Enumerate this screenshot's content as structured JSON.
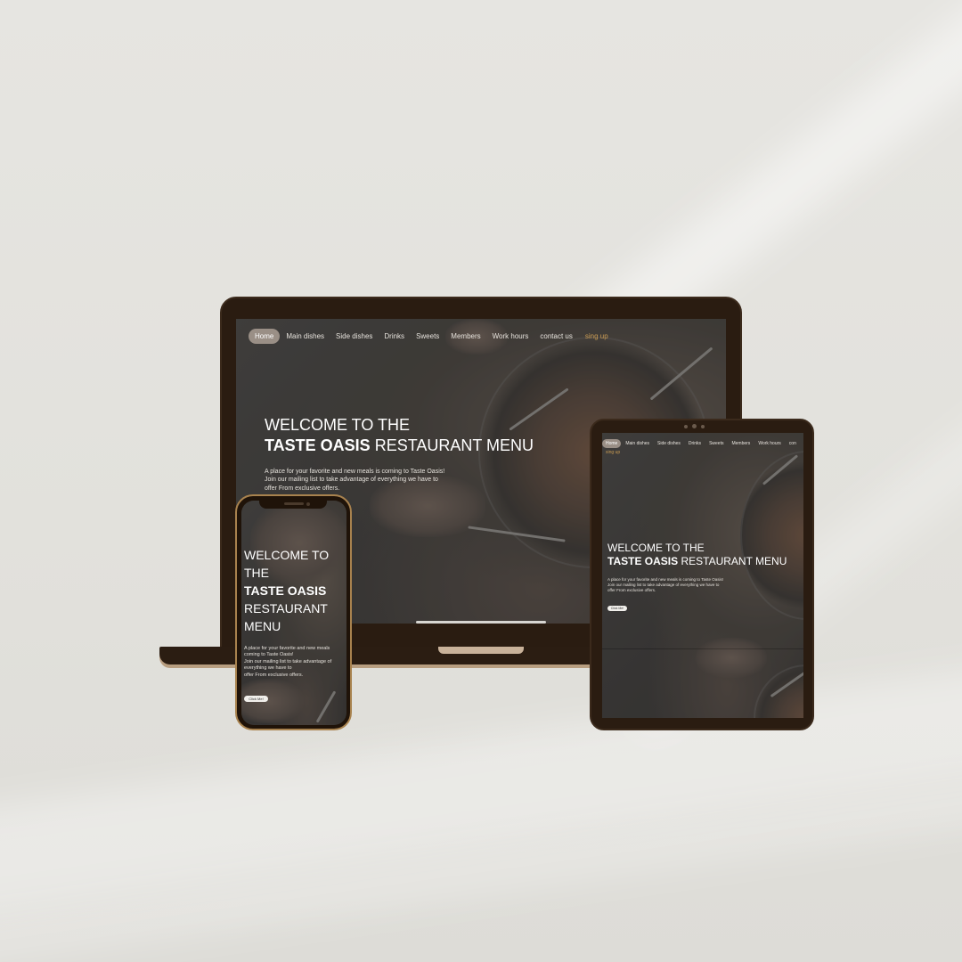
{
  "brand": {
    "device_frame_color": "#2a1c11",
    "phone_frame_color": "#a8824e",
    "accent_signup_color": "#c89a52",
    "active_pill_color": "#9a8f86"
  },
  "nav": {
    "items": [
      "Home",
      "Main dishes",
      "Side dishes",
      "Drinks",
      "Sweets",
      "Members",
      "Work hours",
      "contact us"
    ],
    "tablet_last_item": "con",
    "signup": "sing up",
    "active": "Home"
  },
  "hero": {
    "line1": "WELCOME TO THE",
    "brand_name": "TASTE OASIS",
    "line2_rest": "RESTAURANT MENU",
    "phone_line1a": "WELCOME TO",
    "phone_line1b": "THE",
    "phone_line3": "RESTAURANT",
    "phone_line4": "MENU",
    "desc_l1": "A place for your favorite and new meals is coming to Taste Oasis!",
    "desc_l2": "Join our mailing list to take advantage of everything we have to",
    "desc_l3": "offer From exclusive offers.",
    "tablet_desc_l1": "A place for your favorite and new meals is coming to Taste Oasis!",
    "tablet_desc_l2": "Join our mailing list to take advantage of everything we have to",
    "tablet_desc_l3": "offer From exclusive offers.",
    "phone_desc_l1": "A place for your favorite and new meals",
    "phone_desc_l2": "coming to Taste Oasis!",
    "phone_desc_l3": "Join our mailing list to take advantage of",
    "phone_desc_l4": "everything we have to",
    "phone_desc_l5": "offer From exclusive offers.",
    "cta": "Click Me!"
  },
  "icons": {
    "food_image": "food-plate-photo",
    "camera": "camera-icon"
  }
}
